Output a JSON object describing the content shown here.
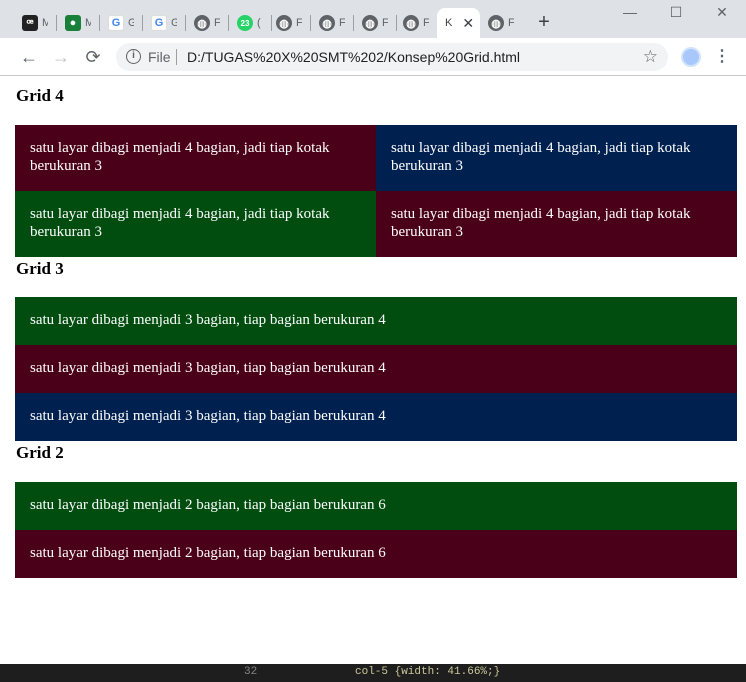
{
  "browser": {
    "tabs": [
      {
        "favicon": "gitbook-icon",
        "label": "M"
      },
      {
        "favicon": "classroom-icon",
        "label": "M"
      },
      {
        "favicon": "google-icon",
        "label": "G"
      },
      {
        "favicon": "google-icon",
        "label": "G"
      },
      {
        "favicon": "globe-icon",
        "label": "F"
      },
      {
        "favicon": "whatsapp-badge-icon",
        "label": "("
      },
      {
        "favicon": "globe-icon",
        "label": "F"
      },
      {
        "favicon": "globe-icon",
        "label": "F"
      },
      {
        "favicon": "globe-icon",
        "label": "F"
      },
      {
        "favicon": "globe-icon",
        "label": "F"
      },
      {
        "favicon": "text",
        "label": "K",
        "active": true
      },
      {
        "favicon": "globe-icon",
        "label": "F"
      }
    ],
    "whatsapp_badge": "23",
    "new_tab": "+",
    "window_controls": {
      "minimize": "—",
      "maximize": "☐",
      "close": "✕"
    },
    "nav": {
      "back": "←",
      "forward": "→",
      "reload": "⟳"
    },
    "scheme": "File",
    "url": "D:/TUGAS%20X%20SMT%202/Konsep%20Grid.html",
    "star": "☆",
    "menu": "⋮"
  },
  "page": {
    "grid4": {
      "title": "Grid 4",
      "cells": [
        "satu layar dibagi menjadi 4 bagian, jadi tiap kotak berukuran 3",
        "satu layar dibagi menjadi 4 bagian, jadi tiap kotak berukuran 3",
        "satu layar dibagi menjadi 4 bagian, jadi tiap kotak berukuran 3",
        "satu layar dibagi menjadi 4 bagian, jadi tiap kotak berukuran 3"
      ]
    },
    "grid3": {
      "title": "Grid 3",
      "cells": [
        "satu layar dibagi menjadi 3 bagian, tiap bagian berukuran 4",
        "satu layar dibagi menjadi 3 bagian, tiap bagian berukuran 4",
        "satu layar dibagi menjadi 3 bagian, tiap bagian berukuran 4"
      ]
    },
    "grid2": {
      "title": "Grid 2",
      "cells": [
        "satu layar dibagi menjadi 2 bagian, tiap bagian berukuran 6",
        "satu layar dibagi menjadi 2 bagian, tiap bagian berukuran 6"
      ]
    }
  },
  "background_code": {
    "line_number": "32",
    "snippet": "col-5 {width: 41.66%;}"
  },
  "colors": {
    "maroon": "#4a0018",
    "navy": "#002050",
    "green": "#004d0f"
  }
}
